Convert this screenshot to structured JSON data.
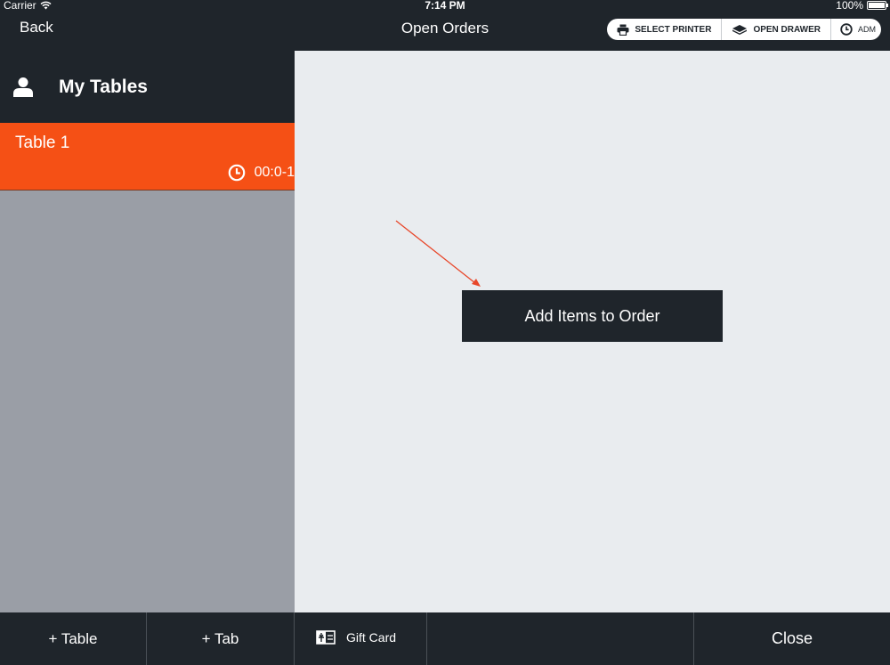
{
  "status_bar": {
    "carrier": "Carrier",
    "time": "7:14 PM",
    "battery": "100%"
  },
  "nav": {
    "back_label": "Back",
    "title": "Open Orders",
    "actions": {
      "select_printer": "SELECT PRINTER",
      "open_drawer": "OPEN DRAWER",
      "adm": "ADM"
    }
  },
  "sidebar": {
    "title": "My Tables",
    "tables": [
      {
        "name": "Table 1",
        "timer": "00:0-1"
      }
    ]
  },
  "main": {
    "add_items_label": "Add Items to Order"
  },
  "bottom_bar": {
    "add_table": "+ Table",
    "add_tab": "+ Tab",
    "gift_card": "Gift Card",
    "close": "Close"
  },
  "colors": {
    "accent": "#f55015",
    "dark": "#1f252b",
    "sidebar_bg": "#9a9ea6",
    "main_bg": "#e9ecef",
    "arrow": "#e8472a"
  }
}
